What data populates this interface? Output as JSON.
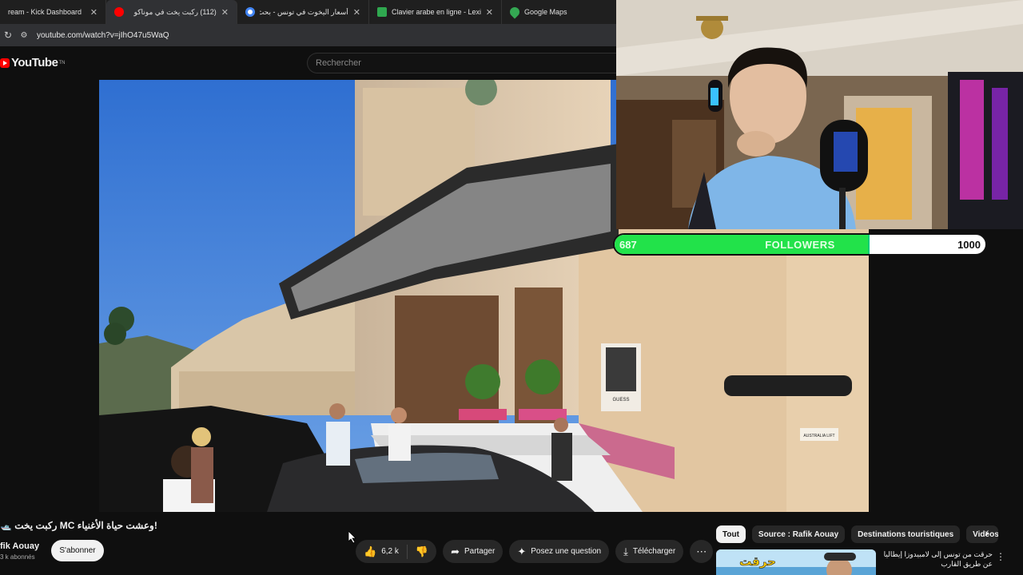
{
  "browser": {
    "tabs": [
      {
        "title": "ream - Kick Dashboard",
        "favicon_color": "#53fc18"
      },
      {
        "title": "(112) ركبت يخت في موناكو",
        "favicon_color": "#ff0000"
      },
      {
        "title": "أسعار اليخوت في تونس - بحث",
        "favicon_color": "#4285f4"
      },
      {
        "title": "Clavier arabe en ligne - Lexilogos",
        "favicon_color": "#2fa84f"
      },
      {
        "title": "Google Maps",
        "favicon_color": "#34a853"
      }
    ],
    "active_tab_index": 1,
    "url": "youtube.com/watch?v=jIhO47u5WaQ"
  },
  "youtube": {
    "logo_text": "YouTube",
    "logo_suffix": "TN",
    "search_placeholder": "Rechercher",
    "video_title": "🛥️ ركبت يخت MC وعشت حياة الأغنياء!",
    "channel_name": "fik Aouay",
    "subscribers": "3 k abonnés",
    "subscribe_label": "S'abonner",
    "likes": "6,2 k",
    "share_label": "Partager",
    "ask_label": "Posez une question",
    "download_label": "Télécharger"
  },
  "chips": [
    "Tout",
    "Source : Rafik Aouay",
    "Destinations touristiques",
    "Vidéos"
  ],
  "recommendation": {
    "thumb_text": "حرقت",
    "title": "حرقت من تونس إلى لامبيدوزا إيطاليا عن طريق القارب"
  },
  "stream_overlay": {
    "followers_current": "687",
    "followers_label": "FOLLOWERS",
    "followers_goal": "1000",
    "followers_fraction": 0.687
  },
  "poster": {
    "brand": "GUESS"
  },
  "sign": {
    "text": "AUSTRALIA LIFT"
  },
  "colors": {
    "youtube_red": "#ff0000",
    "progress_green": "#22e24a",
    "page_bg": "#0f0f0f"
  }
}
